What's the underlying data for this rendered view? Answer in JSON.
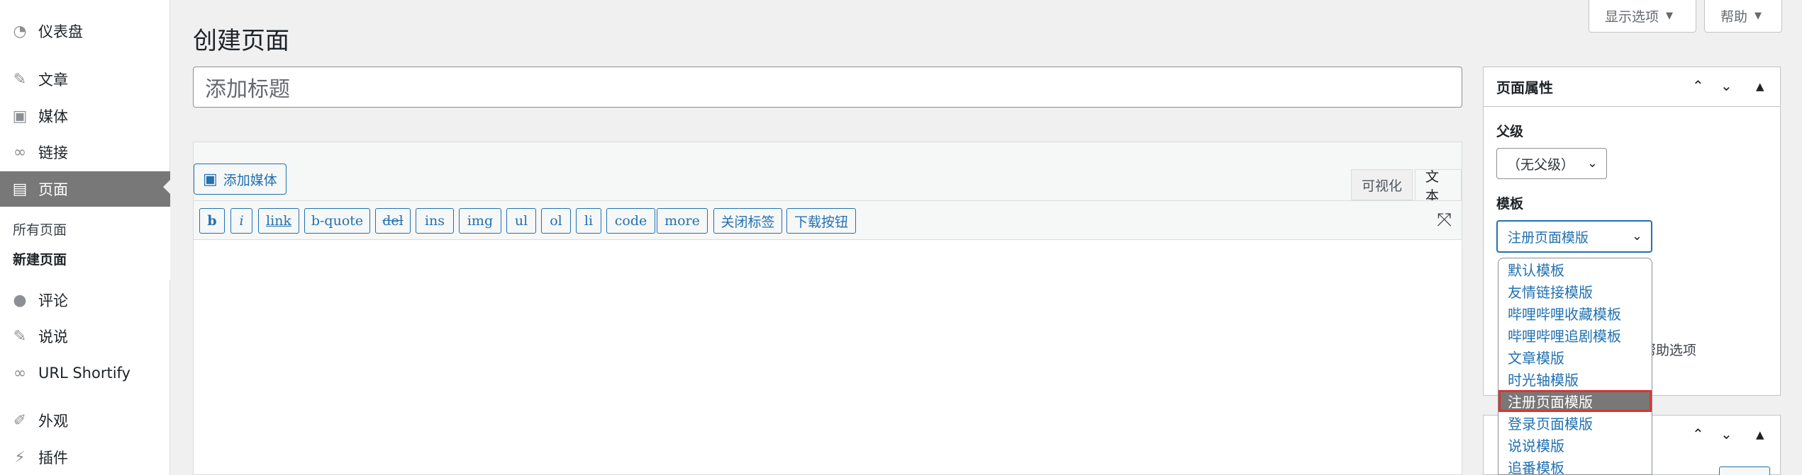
{
  "topbar": {
    "screen_options": "显示选项",
    "help": "帮助"
  },
  "sidebar": {
    "items": [
      {
        "label": "仪表盘",
        "icon": "dashboard-icon",
        "glyph": "◔"
      },
      {
        "label": "文章",
        "icon": "pin-icon",
        "glyph": "✎"
      },
      {
        "label": "媒体",
        "icon": "media-icon",
        "glyph": "▣"
      },
      {
        "label": "链接",
        "icon": "link-icon",
        "glyph": "∞"
      },
      {
        "label": "页面",
        "icon": "page-icon",
        "glyph": "▤"
      },
      {
        "label": "评论",
        "icon": "comment-icon",
        "glyph": "●"
      },
      {
        "label": "说说",
        "icon": "pin-icon",
        "glyph": "✎"
      },
      {
        "label": "URL Shortify",
        "icon": "link-icon",
        "glyph": "∞"
      },
      {
        "label": "外观",
        "icon": "brush-icon",
        "glyph": "✐"
      },
      {
        "label": "插件",
        "icon": "plugin-icon",
        "glyph": "⚡"
      }
    ],
    "submenu": [
      "所有页面",
      "新建页面"
    ]
  },
  "main": {
    "page_title": "创建页面",
    "title_placeholder": "添加标题",
    "add_media": "添加媒体",
    "tab_visual": "可视化",
    "tab_text": "文本",
    "quicktags": [
      "b",
      "i",
      "link",
      "b-quote",
      "del",
      "ins",
      "img",
      "ul",
      "ol",
      "li",
      "code",
      "more",
      "关闭标签",
      "下载按钮"
    ]
  },
  "page_attributes": {
    "title": "页面属性",
    "parent_label": "父级",
    "parent_value": "（无父级）",
    "template_label": "模板",
    "template_value": "注册页面模版",
    "help_text_partial": "题上方的帮助选项",
    "template_options": [
      "默认模板",
      "友情链接模版",
      "哔哩哔哩收藏模板",
      "哔哩哔哩追剧模板",
      "文章模版",
      "时光轴模版",
      "注册页面模版",
      "登录页面模版",
      "说说模版",
      "追番模板"
    ],
    "selected_index": 6
  },
  "colors": {
    "accent": "#2271b1",
    "active_menu": "#787878",
    "highlight_border": "#d63638"
  }
}
